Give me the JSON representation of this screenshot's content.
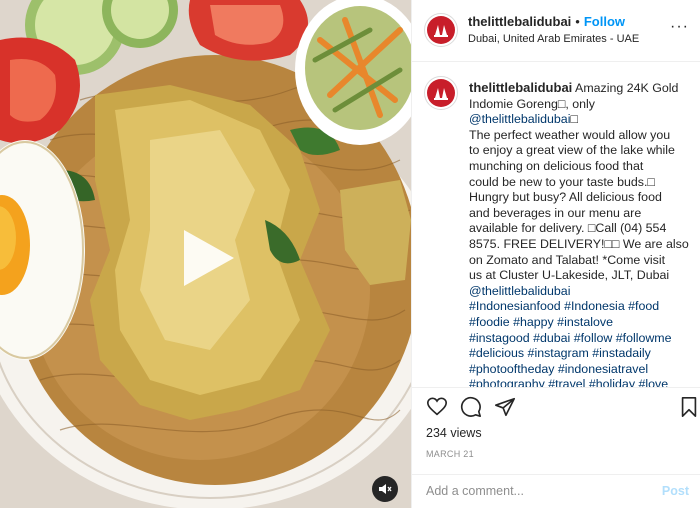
{
  "post": {
    "username": "thelittlebalidubai",
    "separator": "•",
    "follow_label": "Follow",
    "location": "Dubai, United Arab Emirates - UAE",
    "more_label": "···",
    "caption_lines": [
      {
        "text": " Amazing 24K Gold",
        "link": false
      },
      {
        "text": "Indomie Goreng□, only",
        "link": false
      },
      {
        "text": "@thelittlebalidubai",
        "link": true
      },
      {
        "text": "□",
        "link": false
      },
      {
        "text": "The perfect weather would allow you",
        "link": false
      },
      {
        "text": "to enjoy a great view of the lake while",
        "link": false
      },
      {
        "text": "munching on delicious food that",
        "link": false
      },
      {
        "text": "could be new to your taste buds.□",
        "link": false
      },
      {
        "text": "Hungry but busy? All delicious food",
        "link": false
      },
      {
        "text": "and beverages in our menu are",
        "link": false
      },
      {
        "text": "available for delivery. □Call (04) 554",
        "link": false
      },
      {
        "text": "8575. FREE DELIVERY!□□ We are also",
        "link": false
      },
      {
        "text": "on Zomato and Talabat! *Come visit",
        "link": false
      },
      {
        "text": "us at Cluster U-Lakeside, JLT, Dubai",
        "link": false
      },
      {
        "text": "@thelittlebalidubai",
        "link": true
      },
      {
        "text": "#Indonesianfood #Indonesia #food",
        "link": true
      },
      {
        "text": "#foodie #happy #instalove",
        "link": true
      },
      {
        "text": "#instagood #dubai #follow #followme",
        "link": true
      },
      {
        "text": "#delicious #instagram #instadaily",
        "link": true
      },
      {
        "text": "#photooftheday #indonesiatravel",
        "link": true
      },
      {
        "text": "#photography #travel #holiday #love",
        "link": true
      }
    ],
    "views": "234 views",
    "date": "MARCH 21",
    "comment_placeholder": "Add a comment...",
    "post_label": "Post",
    "icons": [
      "heart-icon",
      "comment-icon",
      "share-icon",
      "bookmark-icon",
      "play-icon",
      "mute-icon"
    ],
    "colors": {
      "link": "#00376b",
      "follow": "#0095f6",
      "post_disabled": "#b2dffc",
      "avatar_red": "#c81e2a"
    }
  }
}
